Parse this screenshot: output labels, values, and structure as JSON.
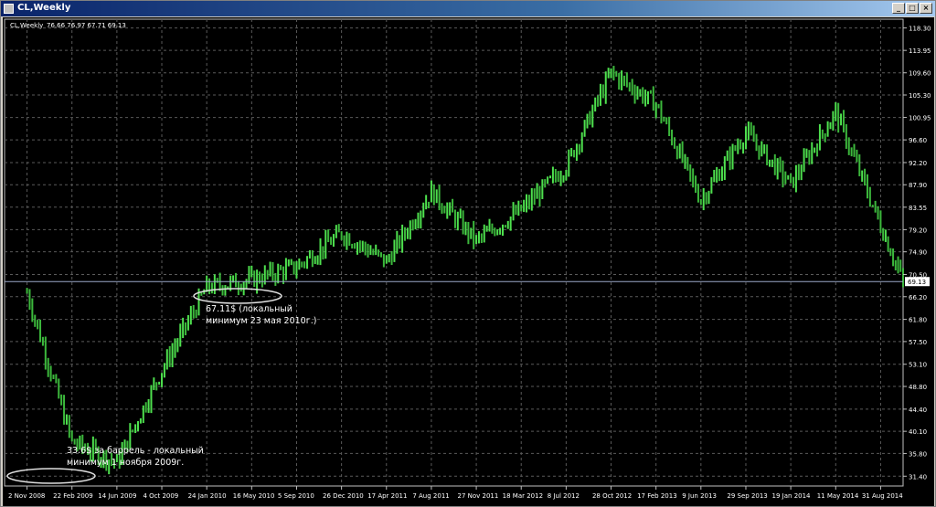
{
  "window": {
    "title": "CL,Weekly"
  },
  "chart_data": {
    "type": "line",
    "info_symbol": "CL,Weekly",
    "ohlc": "76.66 76.97 67.71 69.13",
    "current_price": "69.13",
    "ylim": [
      29.5,
      120.0
    ],
    "y_ticks": [
      "118.30",
      "113.95",
      "109.60",
      "105.30",
      "100.95",
      "96.60",
      "92.20",
      "87.90",
      "83.55",
      "79.20",
      "74.90",
      "70.50",
      "66.20",
      "61.80",
      "57.50",
      "53.10",
      "48.80",
      "44.40",
      "40.10",
      "35.80",
      "31.40"
    ],
    "x_ticks": [
      "2 Nov 2008",
      "22 Feb 2009",
      "14 Jun 2009",
      "4 Oct 2009",
      "24 Jan 2010",
      "16 May 2010",
      "5 Sep 2010",
      "26 Dec 2010",
      "17 Apr 2011",
      "7 Aug 2011",
      "27 Nov 2011",
      "18 Mar 2012",
      "8 Jul 2012",
      "28 Oct 2012",
      "17 Feb 2013",
      "9 Jun 2013",
      "29 Sep 2013",
      "19 Jan 2014",
      "11 May 2014",
      "31 Aug 2014"
    ],
    "series": [
      {
        "x": [
          0,
          1,
          2,
          3,
          4,
          5,
          6,
          7,
          8,
          9,
          10,
          11,
          12,
          13,
          14,
          15,
          16,
          17,
          18,
          19,
          19.5
        ],
        "y": [
          67.0,
          38.0,
          34.0,
          52.0,
          68.0,
          69.5,
          72.0,
          78.5,
          73.0,
          86.5,
          77.0,
          83.0,
          91.5,
          109.6,
          103.5,
          85.0,
          98.0,
          88.0,
          102.0,
          80.0,
          69.13
        ]
      }
    ],
    "annotations": [
      {
        "id": "low-2010",
        "line1": "67.11$ (локальный",
        "line2": "минимум 23 мая 2010г.)"
      },
      {
        "id": "low-2009",
        "line1": "33.6$ за баррель - локальный",
        "line2": "минимум 1 ноября 2009г."
      }
    ]
  }
}
